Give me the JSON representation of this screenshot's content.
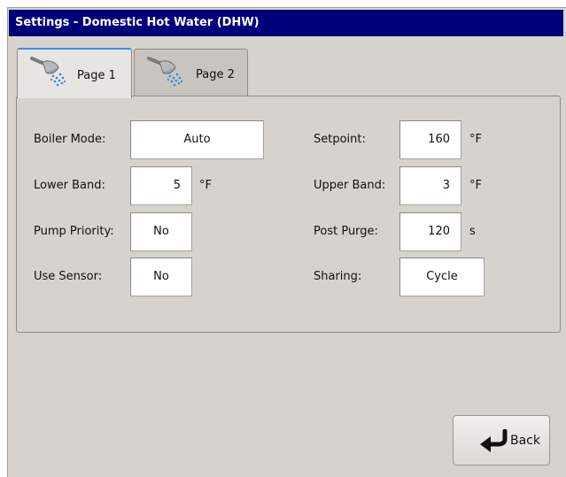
{
  "window": {
    "title": "Settings - Domestic Hot Water (DHW)"
  },
  "tabs": [
    {
      "label": "Page 1",
      "icon": "shower-head-icon",
      "active": true
    },
    {
      "label": "Page 2",
      "icon": "shower-head-icon",
      "active": false
    }
  ],
  "fields": {
    "boiler_mode": {
      "label": "Boiler Mode:",
      "value": "Auto"
    },
    "setpoint": {
      "label": "Setpoint:",
      "value": "160",
      "unit": "°F"
    },
    "lower_band": {
      "label": "Lower Band:",
      "value": "5",
      "unit": "°F"
    },
    "upper_band": {
      "label": "Upper Band:",
      "value": "3",
      "unit": "°F"
    },
    "pump_priority": {
      "label": "Pump Priority:",
      "value": "No"
    },
    "post_purge": {
      "label": "Post Purge:",
      "value": "120",
      "unit": "s"
    },
    "use_sensor": {
      "label": "Use Sensor:",
      "value": "No"
    },
    "sharing": {
      "label": "Sharing:",
      "value": "Cycle"
    }
  },
  "back_button": {
    "label": "Back",
    "icon": "back-arrow-icon"
  },
  "colors": {
    "titlebar": "#00007a",
    "panel": "#d6d3cf",
    "tab_accent": "#3a8ee6"
  }
}
